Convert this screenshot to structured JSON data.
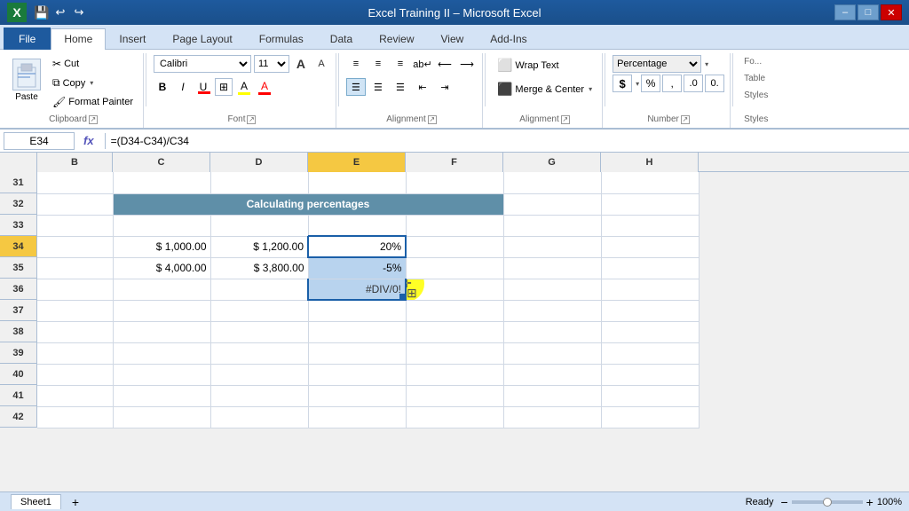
{
  "titleBar": {
    "title": "Excel Training II – Microsoft Excel",
    "windowControls": [
      "–",
      "□",
      "✕"
    ]
  },
  "ribbonTabs": {
    "tabs": [
      "File",
      "Home",
      "Insert",
      "Page Layout",
      "Formulas",
      "Data",
      "Review",
      "View",
      "Add-Ins"
    ]
  },
  "clipboard": {
    "pasteLabel": "Paste",
    "cutLabel": "Cut",
    "copyLabel": "Copy",
    "formatPainterLabel": "Format Painter",
    "groupLabel": "Clipboard"
  },
  "font": {
    "fontName": "Calibri",
    "fontSize": "11",
    "bold": "B",
    "italic": "I",
    "underline": "U",
    "groupLabel": "Font"
  },
  "alignment": {
    "groupLabel": "Alignment",
    "wrapText": "Wrap Text",
    "mergeCenter": "Merge & Center"
  },
  "number": {
    "format": "Percentage",
    "groupLabel": "Number",
    "dollar": "$",
    "percent": "%",
    "comma": ","
  },
  "formulaBar": {
    "nameBox": "E34",
    "fx": "fx",
    "formula": "=(D34-C34)/C34"
  },
  "columns": {
    "headers": [
      "B",
      "C",
      "D",
      "E",
      "F",
      "G",
      "H"
    ],
    "widths": [
      85,
      110,
      110,
      110,
      110,
      110,
      110
    ]
  },
  "rows": {
    "headers": [
      "31",
      "32",
      "33",
      "34",
      "35",
      "36",
      "37",
      "38",
      "39",
      "40",
      "41",
      "42"
    ],
    "rowNumbers": [
      31,
      32,
      33,
      34,
      35,
      36,
      37,
      38,
      39,
      40,
      41,
      42
    ]
  },
  "cells": {
    "mergeHeader": "Calculating percentages",
    "c34": "$ 1,000.00",
    "d34": "$ 1,200.00",
    "e34": "20%",
    "c35": "$ 4,000.00",
    "d35": "$ 3,800.00",
    "e35": "-5%",
    "e36": "#DIV/0!"
  },
  "bottomBar": {
    "ready": "Ready",
    "zoom": "100%"
  }
}
